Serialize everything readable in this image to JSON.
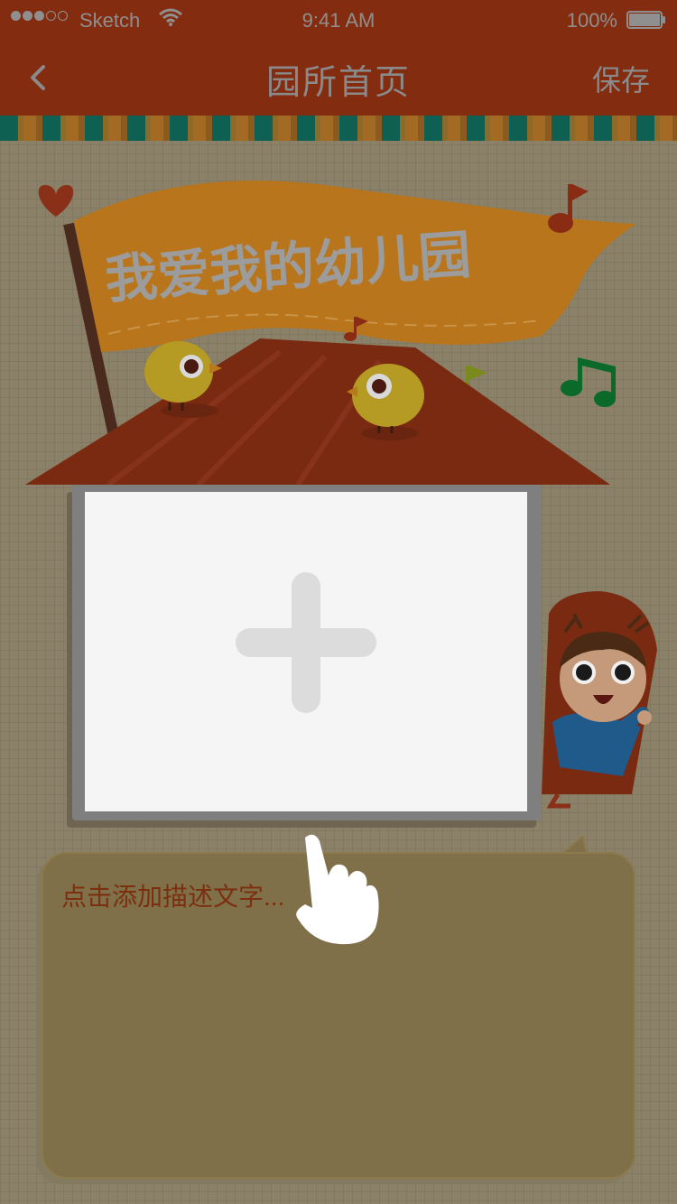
{
  "status_bar": {
    "carrier": "Sketch",
    "time": "9:41 AM",
    "battery_percent": "100%",
    "signal_bars": 3,
    "signal_total": 5,
    "battery_level": 1.0,
    "icons": [
      "signal-dots-icon",
      "wifi-icon",
      "battery-icon"
    ]
  },
  "nav": {
    "back_icon": "chevron-left-icon",
    "title": "园所首页",
    "save_label": "保存"
  },
  "banner": {
    "text": "我爱我的幼儿园"
  },
  "photo": {
    "add_icon": "plus-icon"
  },
  "description": {
    "placeholder": "点击添加描述文字..."
  },
  "colors": {
    "nav_bg": "#832c0f",
    "stripe_teal": "#0e6152",
    "stripe_ochre": "#a36a24",
    "page_bg": "#8a8168",
    "flag": "#b8751b",
    "roof": "#7b2a12",
    "desc_text": "#7c2f0f"
  }
}
